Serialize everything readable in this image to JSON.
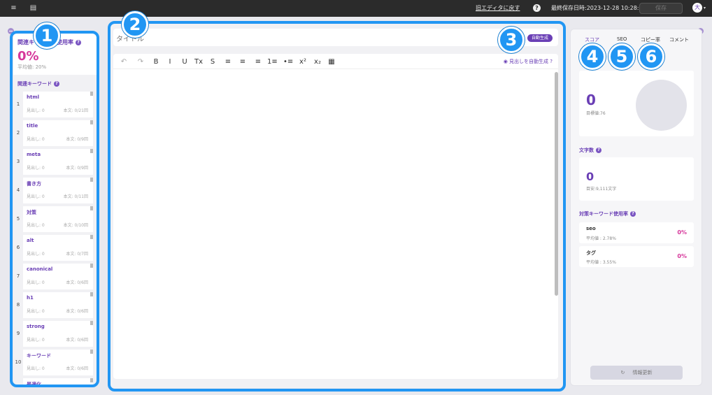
{
  "topbar": {
    "menu_icon": "≡",
    "doc_icon": "▤",
    "old_editor_link": "旧エディタに戻す",
    "help": "?",
    "last_saved": "最終保存日時:2023-12-28 10:28:56",
    "save_label": "保存",
    "avatar": "大"
  },
  "left_panel": {
    "title": "関連キーワード使用率",
    "usage_pct": "0%",
    "avg": "平均値: 20%",
    "keyword_section_title": "関連キーワード",
    "keywords": [
      {
        "num": "1",
        "name": "html",
        "heading": "見出し: 0",
        "body": "本文: 0/21回"
      },
      {
        "num": "2",
        "name": "title",
        "heading": "見出し: 0",
        "body": "本文: 0/9回"
      },
      {
        "num": "3",
        "name": "meta",
        "heading": "見出し: 0",
        "body": "本文: 0/9回"
      },
      {
        "num": "4",
        "name": "書き方",
        "heading": "見出し: 0",
        "body": "本文: 0/11回"
      },
      {
        "num": "5",
        "name": "対策",
        "heading": "見出し: 0",
        "body": "本文: 0/10回"
      },
      {
        "num": "6",
        "name": "alt",
        "heading": "見出し: 0",
        "body": "本文: 0/7回"
      },
      {
        "num": "7",
        "name": "canonical",
        "heading": "見出し: 0",
        "body": "本文: 0/6回"
      },
      {
        "num": "8",
        "name": "h1",
        "heading": "見出し: 0",
        "body": "本文: 0/6回"
      },
      {
        "num": "9",
        "name": "strong",
        "heading": "見出し: 0",
        "body": "本文: 0/6回"
      },
      {
        "num": "10",
        "name": "キーワード",
        "heading": "見出し: 0",
        "body": "本文: 0/6回"
      },
      {
        "num": "11",
        "name": "最適化",
        "heading": "",
        "body": ""
      }
    ]
  },
  "editor": {
    "title_placeholder": "タイトル",
    "auto_generate": "自動生成",
    "auto_heading": "見出しを自動生成",
    "toolbar": [
      "↶",
      "↷",
      "B",
      "I",
      "U",
      "Tx",
      "S",
      "≡",
      "≡",
      "≡",
      "1≡",
      "•≡",
      "x²",
      "x₂",
      "▦"
    ]
  },
  "right_panel": {
    "tabs": [
      "スコア",
      "SEO",
      "コピー率",
      "コメント"
    ],
    "score_value": "0",
    "score_target": "目標値:76",
    "char_count_label": "文字数",
    "char_count_value": "0",
    "char_count_target": "目安:9,111文字",
    "target_kw_label": "対策キーワード使用率",
    "target_keywords": [
      {
        "name": "seo",
        "avg": "平均値 : 2.78%",
        "pct": "0%"
      },
      {
        "name": "タグ",
        "avg": "平均値 : 3.55%",
        "pct": "0%"
      }
    ],
    "refresh_label": "情報更新"
  },
  "annotations": [
    "1",
    "2",
    "3",
    "4",
    "5",
    "6"
  ],
  "colors": {
    "accent": "#6a3fb5",
    "pink": "#d6389b",
    "highlight": "#2196f3"
  }
}
